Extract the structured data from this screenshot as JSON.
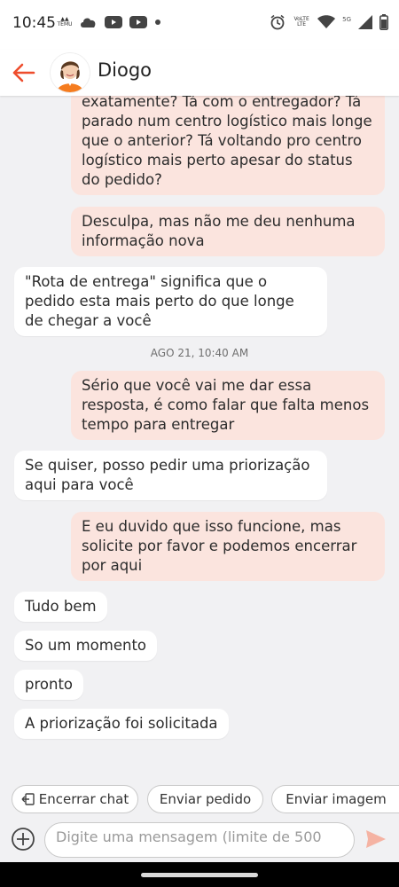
{
  "status_bar": {
    "time": "10:45",
    "left_icons": [
      "temu-icon",
      "cloud-icon",
      "youtube-icon",
      "youtube-icon",
      "dot-icon"
    ],
    "temu_label": "TEMU",
    "right_icons": [
      "alarm-icon",
      "volte-icon",
      "wifi-icon",
      "5g-icon",
      "signal-icon",
      "battery-icon"
    ],
    "volte_label": "VoLTE",
    "network_label": "5G"
  },
  "header": {
    "contact_name": "Diogo"
  },
  "messages": [
    {
      "from": "me",
      "text": "exatamente? Tá com o entregador? Tá parado num centro logístico mais longe que o anterior? Tá voltando pro centro logístico mais perto apesar do status do pedido?"
    },
    {
      "from": "me",
      "text": "Desculpa, mas não me deu nenhuma informação nova"
    },
    {
      "from": "agent",
      "text": "\"Rota de entrega\" significa que o pedido esta mais perto do que longe de chegar a você"
    },
    {
      "from": "agent",
      "text": "AGO 21, 10:40 AM"
    },
    {
      "from": "me",
      "text": "Sério que você vai me dar essa resposta, é como falar que falta menos tempo para entregar"
    },
    {
      "from": "agent",
      "text": "Se quiser, posso pedir uma priorização aqui para você"
    },
    {
      "from": "me",
      "text": "E eu duvido que isso funcione, mas solicite por favor e podemos encerrar por aqui"
    },
    {
      "from": "agent",
      "text": "Tudo bem"
    },
    {
      "from": "agent",
      "text": "So um momento"
    },
    {
      "from": "agent",
      "text": "pronto"
    },
    {
      "from": "agent",
      "text": "A priorização foi solicitada"
    }
  ],
  "actions": {
    "end_chat": "Encerrar chat",
    "send_order": "Enviar pedido",
    "send_image": "Enviar imagem"
  },
  "composer": {
    "placeholder": "Digite uma mensagem (limite de 500"
  },
  "colors": {
    "accent": "#ee4d2d",
    "my_bubble": "#fbe4de",
    "agent_bubble": "#ffffff",
    "background": "#f1f1f3"
  }
}
